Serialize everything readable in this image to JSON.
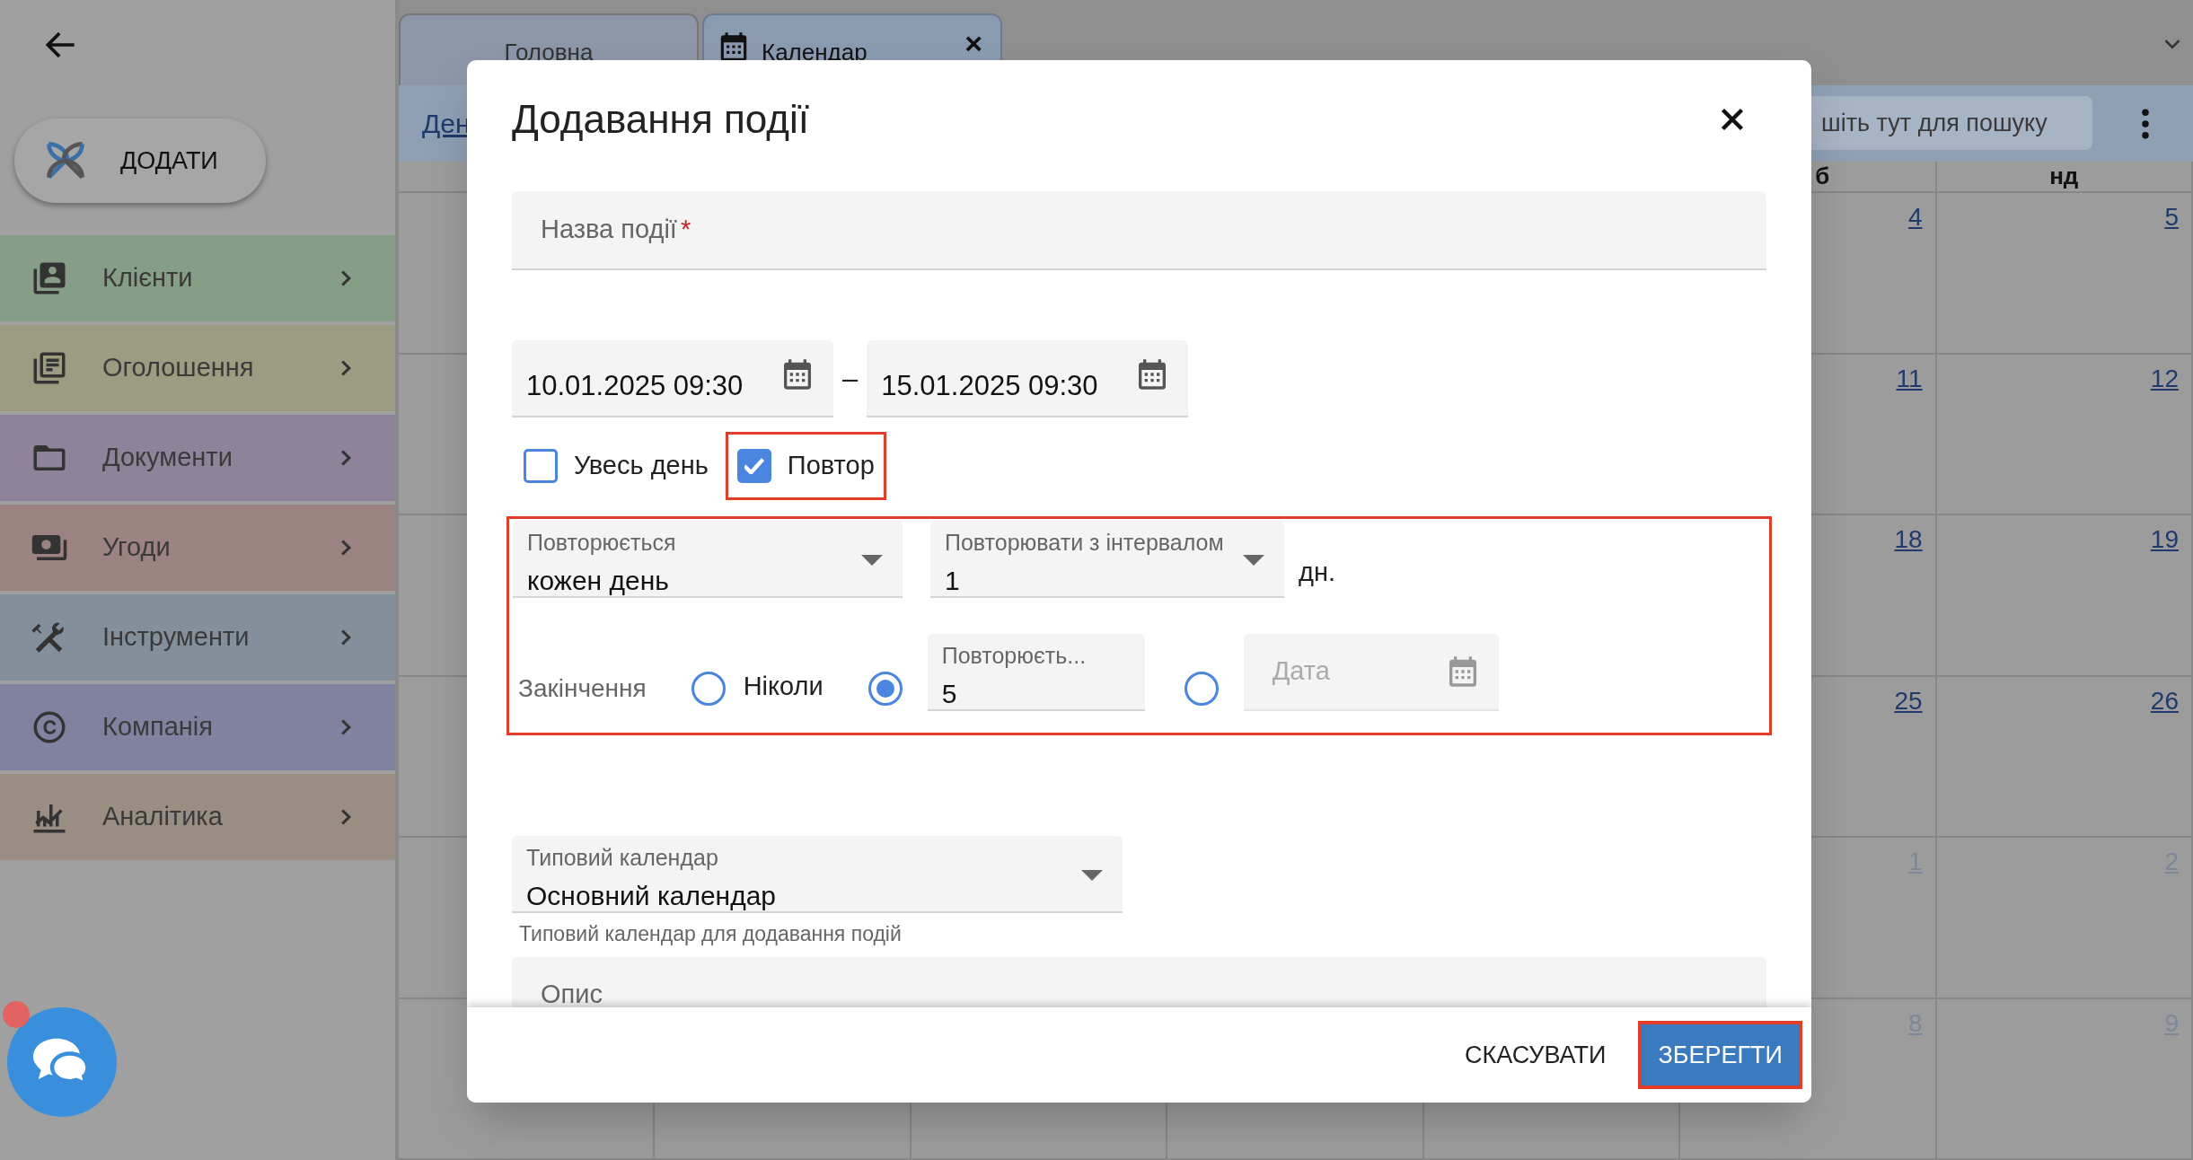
{
  "sidebar": {
    "add_button": "ДОДАТИ",
    "items": [
      {
        "label": "Клієнти",
        "color": "#879e86"
      },
      {
        "label": "Оголошення",
        "color": "#9c9c82"
      },
      {
        "label": "Документи",
        "color": "#8e8399"
      },
      {
        "label": "Угоди",
        "color": "#9a8381"
      },
      {
        "label": "Інструменти",
        "color": "#83909c"
      },
      {
        "label": "Компанія",
        "color": "#8182a0"
      },
      {
        "label": "Аналітика",
        "color": "#9a8e83"
      }
    ],
    "chat": {
      "unread": true
    }
  },
  "tabs": [
    {
      "label": "Головна",
      "selected": false
    },
    {
      "label": "Календар",
      "selected": true,
      "close": "×"
    }
  ],
  "toolbar": {
    "view_link": "Ден",
    "search_placeholder": "шіть тут для пошуку"
  },
  "calendar": {
    "headers": [
      "б",
      "нд"
    ],
    "weeks": [
      {
        "days": [
          "4",
          "5"
        ],
        "other_month": false
      },
      {
        "days": [
          "11",
          "12"
        ],
        "other_month": false
      },
      {
        "days": [
          "18",
          "19"
        ],
        "other_month": false
      },
      {
        "days": [
          "25",
          "26"
        ],
        "other_month": false
      },
      {
        "days": [
          "1",
          "2"
        ],
        "other_month": true
      },
      {
        "days": [
          "8",
          "9"
        ],
        "other_month": true
      }
    ]
  },
  "dialog": {
    "title": "Додавання події",
    "name_field": {
      "placeholder": "Назва події",
      "required_mark": "*"
    },
    "start": "10.01.2025 09:30",
    "separator": "–",
    "end": "15.01.2025 09:30",
    "checkboxes": [
      {
        "label": "Увесь день",
        "checked": false,
        "highlighted": false
      },
      {
        "label": "Повтор",
        "checked": true,
        "highlighted": true
      }
    ],
    "repeat": {
      "highlighted": true,
      "frequency": {
        "label": "Повторюється",
        "value": "кожен день"
      },
      "interval": {
        "label": "Повторювати з інтервалом",
        "value": "1"
      },
      "unit": "дн.",
      "end_label": "Закінчення",
      "end_options": [
        {
          "kind": "text",
          "label": "Ніколи",
          "selected": false
        },
        {
          "kind": "count",
          "label": "Повторюєть...",
          "value": "5",
          "selected": true
        },
        {
          "kind": "date",
          "placeholder": "Дата",
          "selected": false
        }
      ]
    },
    "calendar_select": {
      "label": "Типовий календар",
      "value": "Основний календар",
      "helper": "Типовий календар для додавання подій"
    },
    "description": {
      "placeholder": "Опис"
    },
    "cancel": "СКАСУВАТИ",
    "save": {
      "label": "ЗБЕРЕГТИ",
      "highlighted": true
    }
  }
}
